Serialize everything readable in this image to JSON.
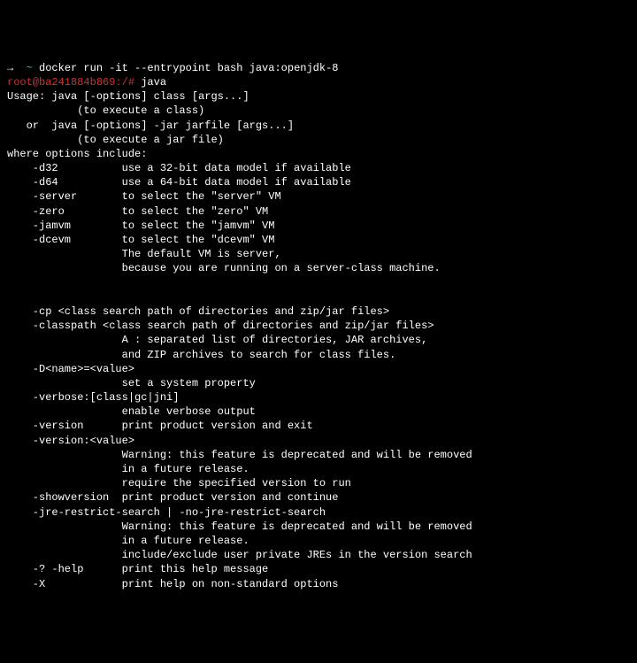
{
  "line1_arrow": "→  ",
  "line1_tilde": "~ ",
  "line1_cmd": "docker run -it --entrypoint bash java:openjdk-8",
  "line2_prompt": "root@ba241884b869:/# ",
  "line2_cmd": "java",
  "line3": "Usage: java [-options] class [args...]",
  "line4": "           (to execute a class)",
  "line5": "   or  java [-options] -jar jarfile [args...]",
  "line6": "           (to execute a jar file)",
  "line7": "where options include:",
  "line8": "    -d32          use a 32-bit data model if available",
  "line9": "    -d64          use a 64-bit data model if available",
  "line10": "    -server       to select the \"server\" VM",
  "line11": "    -zero         to select the \"zero\" VM",
  "line12": "    -jamvm        to select the \"jamvm\" VM",
  "line13": "    -dcevm        to select the \"dcevm\" VM",
  "line14": "                  The default VM is server,",
  "line15": "                  because you are running on a server-class machine.",
  "line16": "",
  "line17": "",
  "line18": "    -cp <class search path of directories and zip/jar files>",
  "line19": "    -classpath <class search path of directories and zip/jar files>",
  "line20": "                  A : separated list of directories, JAR archives,",
  "line21": "                  and ZIP archives to search for class files.",
  "line22": "    -D<name>=<value>",
  "line23": "                  set a system property",
  "line24": "    -verbose:[class|gc|jni]",
  "line25": "                  enable verbose output",
  "line26": "    -version      print product version and exit",
  "line27": "    -version:<value>",
  "line28": "                  Warning: this feature is deprecated and will be removed",
  "line29": "                  in a future release.",
  "line30": "                  require the specified version to run",
  "line31": "    -showversion  print product version and continue",
  "line32": "    -jre-restrict-search | -no-jre-restrict-search",
  "line33": "                  Warning: this feature is deprecated and will be removed",
  "line34": "                  in a future release.",
  "line35": "                  include/exclude user private JREs in the version search",
  "line36": "    -? -help      print this help message",
  "line37": "    -X            print help on non-standard options"
}
